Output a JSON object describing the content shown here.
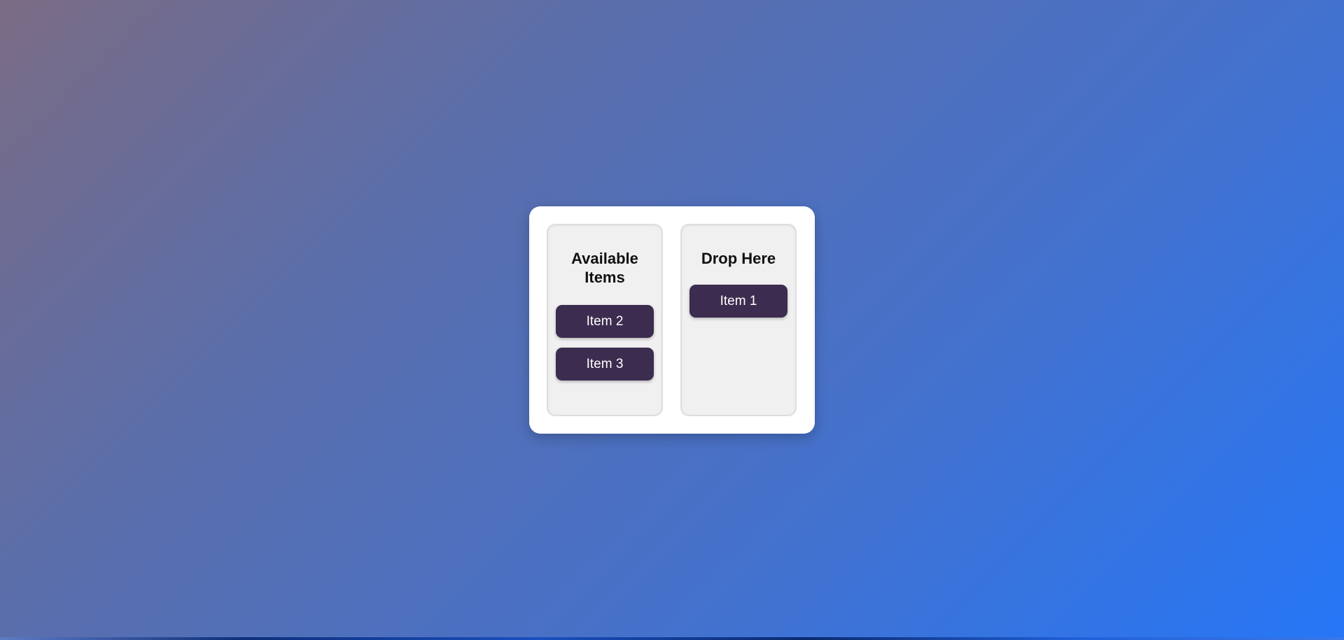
{
  "source_column": {
    "title": "Available Items",
    "items": [
      {
        "label": "Item 2"
      },
      {
        "label": "Item 3"
      }
    ]
  },
  "target_column": {
    "title": "Drop Here",
    "items": [
      {
        "label": "Item 1"
      }
    ]
  },
  "colors": {
    "item_background": "#3c2c4f",
    "column_background": "#f0f0f0",
    "card_background": "#ffffff",
    "page_gradient_start": "#7a6b84",
    "page_gradient_end": "#2676f7"
  }
}
